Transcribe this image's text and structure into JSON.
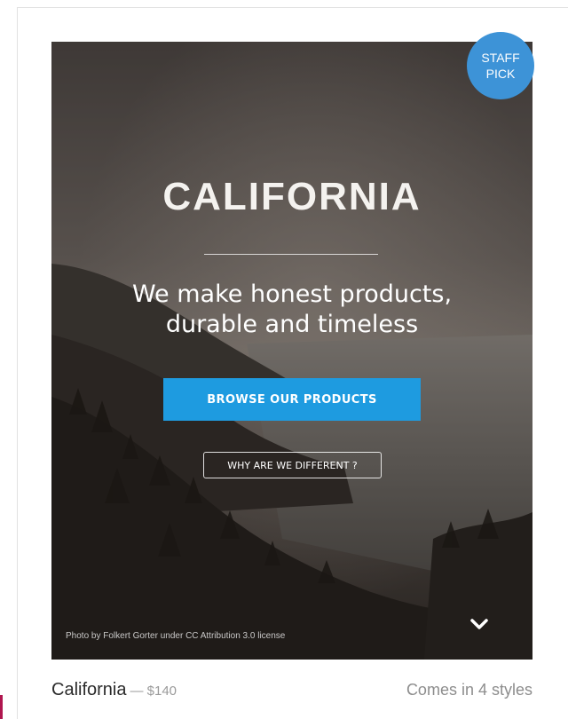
{
  "badge": {
    "line1": "STAFF",
    "line2": "PICK",
    "color": "#3d93d7"
  },
  "hero": {
    "title": "CALIFORNIA",
    "tagline_line1": "We make honest products,",
    "tagline_line2": "durable and timeless",
    "primary_button": "BROWSE OUR PRODUCTS",
    "secondary_button": "WHY ARE WE DIFFERENT ?",
    "photo_credit": "Photo by Folkert Gorter under CC Attribution 3.0 license",
    "scroll_icon": "chevron-down-icon"
  },
  "product": {
    "name": "California",
    "price": "— $140",
    "styles": "Comes in 4 styles"
  },
  "colors": {
    "accent": "#1e9be0",
    "badge": "#3d93d7",
    "left_accent": "#b0164f"
  }
}
